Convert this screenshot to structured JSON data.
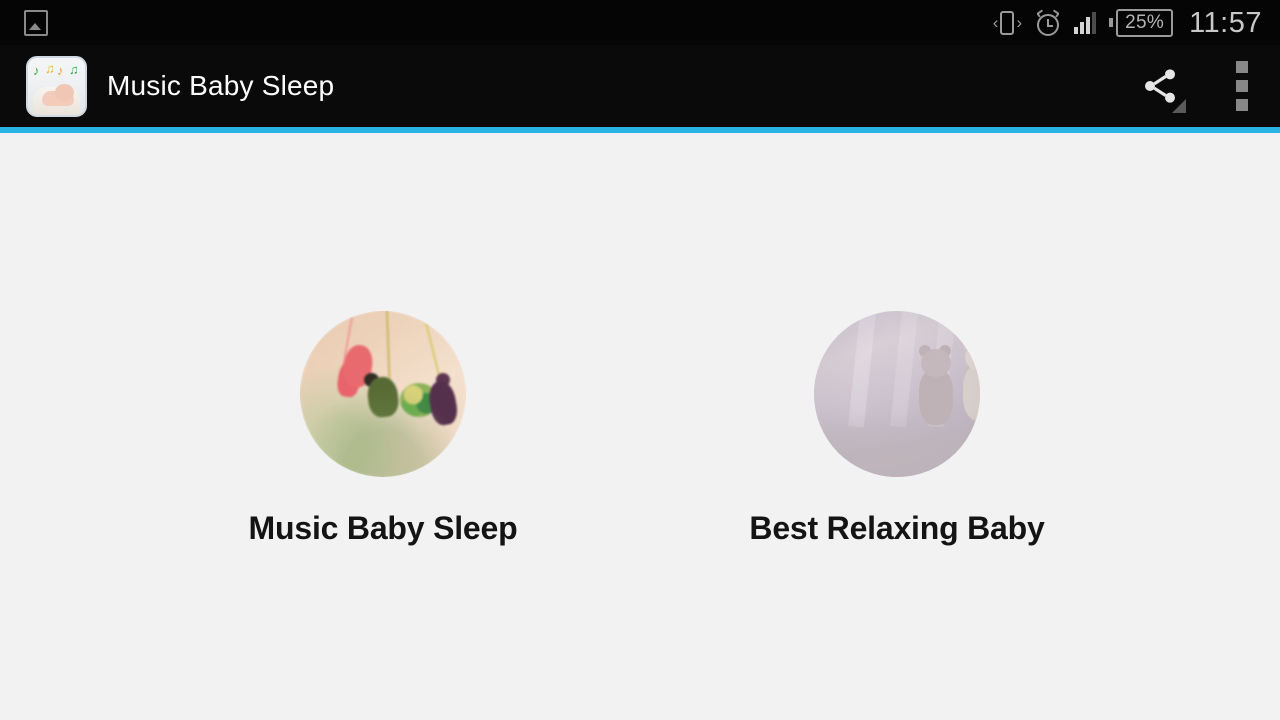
{
  "status_bar": {
    "left_icon": "screenshot-icon",
    "icons": [
      "vibrate-icon",
      "alarm-clock-icon",
      "signal-bars-icon"
    ],
    "battery_level": "25%",
    "time": "11:57"
  },
  "action_bar": {
    "app_icon": "app-logo-baby-music-icon",
    "title": "Music Baby Sleep",
    "share_icon": "share-icon",
    "overflow_icon": "overflow-menu-icon",
    "accent_color": "#29b4e3",
    "background_color": "#0a0a0a"
  },
  "content": {
    "background_color": "#f2f2f2",
    "tiles": [
      {
        "label": "Music Baby Sleep",
        "image": "baby-mobile-knitted-animals-thumbnail"
      },
      {
        "label": "Best Relaxing Baby",
        "image": "hanging-teddy-bears-thumbnail"
      }
    ]
  }
}
